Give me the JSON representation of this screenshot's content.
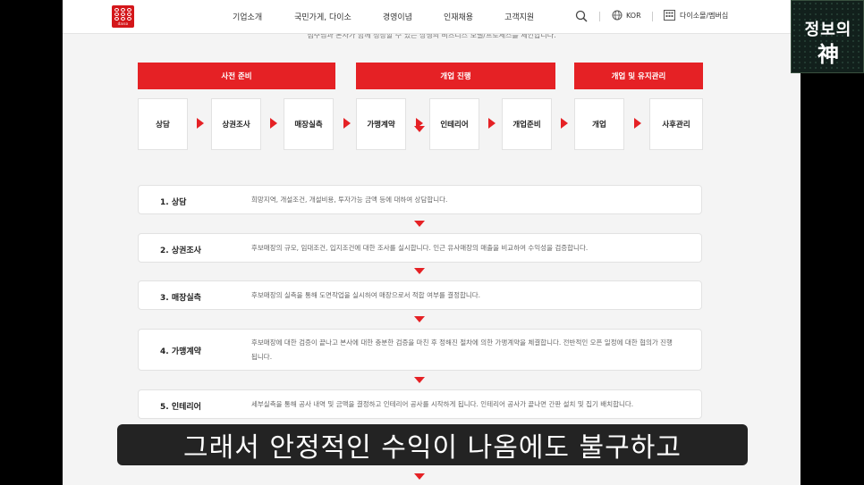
{
  "header": {
    "logo_text": "daiso",
    "nav": [
      "기업소개",
      "국민가게, 다이소",
      "경영이념",
      "인재채용",
      "고객지원"
    ],
    "lang": "KOR",
    "sitemap": "다이소몰/멤버십"
  },
  "intro_text": "점주님과 본사가 함께 성장할 수 있는 상생의 비즈니스 모델/프로세스를 제안합니다.",
  "phases": [
    "사전 준비",
    "개업 진행",
    "개업 및 유지관리"
  ],
  "steps": [
    "상담",
    "상권조사",
    "매장실측",
    "가맹계약",
    "인테리어",
    "개업준비",
    "개업",
    "사후관리"
  ],
  "details": [
    {
      "title": "1. 상담",
      "desc": "희망지역, 개설조건, 개설비용, 투자가능 금액 등에 대하여 상담합니다."
    },
    {
      "title": "2. 상권조사",
      "desc": "후보매장의 규모, 임대조건, 입지조건에 대한 조사를 실시합니다. 인근 유사매장의 매출을 비교하여 수익성을 검증합니다."
    },
    {
      "title": "3. 매장실측",
      "desc": "후보매장의 실측을 통해 도면작업을 실시하여 매장으로서 적합 여부를 결정합니다."
    },
    {
      "title": "4. 가맹계약",
      "desc": "후보매장에 대한 검증이 끝나고 본사에 대한 충분한 검증을 마친 후 정해진 절차에 의한 가맹계약을 체결합니다. 전반적인 오픈 일정에 대한 협의가 진행됩니다."
    },
    {
      "title": "5. 인테리어",
      "desc": "세부실측을 통해 공사 내역 및 금액을 결정하고 인테리어 공사를 시작하게 됩니다. 인테리어 공사가 끝나면 간판 설치 및 집기 배치합니다."
    }
  ],
  "badge": {
    "line1": "정보의",
    "line2": "神"
  },
  "subtitle": "그래서 안정적인 수익이 나옴에도 불구하고",
  "colors": {
    "accent": "#e52125",
    "logo": "#d4161a"
  }
}
